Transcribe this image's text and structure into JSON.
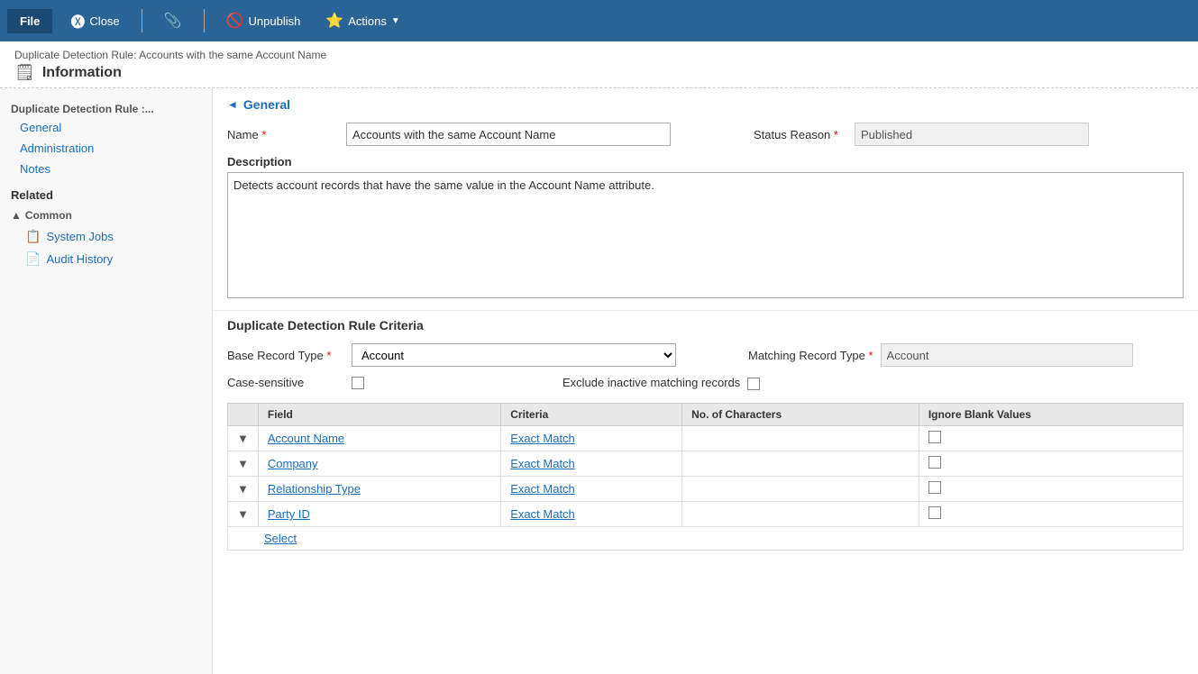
{
  "toolbar": {
    "file_label": "File",
    "close_label": "Close",
    "unpublish_label": "Unpublish",
    "actions_label": "Actions"
  },
  "breadcrumb": "Duplicate Detection Rule: Accounts with the same Account Name",
  "page_title": "Information",
  "sidebar": {
    "nav_title": "Duplicate Detection Rule :...",
    "nav_items": [
      {
        "label": "General",
        "active": true
      },
      {
        "label": "Administration"
      },
      {
        "label": "Notes"
      }
    ],
    "related_title": "Related",
    "common_header": "Common",
    "common_items": [
      {
        "label": "System Jobs",
        "icon": "📋"
      },
      {
        "label": "Audit History",
        "icon": "📄"
      }
    ]
  },
  "general": {
    "section_title": "General",
    "name_label": "Name",
    "name_value": "Accounts with the same Account Name",
    "status_reason_label": "Status Reason",
    "status_reason_value": "Published",
    "description_label": "Description",
    "description_value": "Detects account records that have the same value in the Account Name attribute."
  },
  "criteria": {
    "section_title": "Duplicate Detection Rule Criteria",
    "base_record_type_label": "Base Record Type",
    "base_record_type_value": "Account",
    "matching_record_type_label": "Matching Record Type",
    "matching_record_type_value": "Account",
    "case_sensitive_label": "Case-sensitive",
    "exclude_inactive_label": "Exclude inactive matching records",
    "table_headers": [
      "Field",
      "Criteria",
      "No. of Characters",
      "Ignore Blank Values"
    ],
    "rows": [
      {
        "field": "Account Name",
        "criteria": "Exact Match"
      },
      {
        "field": "Company",
        "criteria": "Exact Match"
      },
      {
        "field": "Relationship Type",
        "criteria": "Exact Match"
      },
      {
        "field": "Party ID",
        "criteria": "Exact Match"
      }
    ],
    "select_label": "Select"
  }
}
